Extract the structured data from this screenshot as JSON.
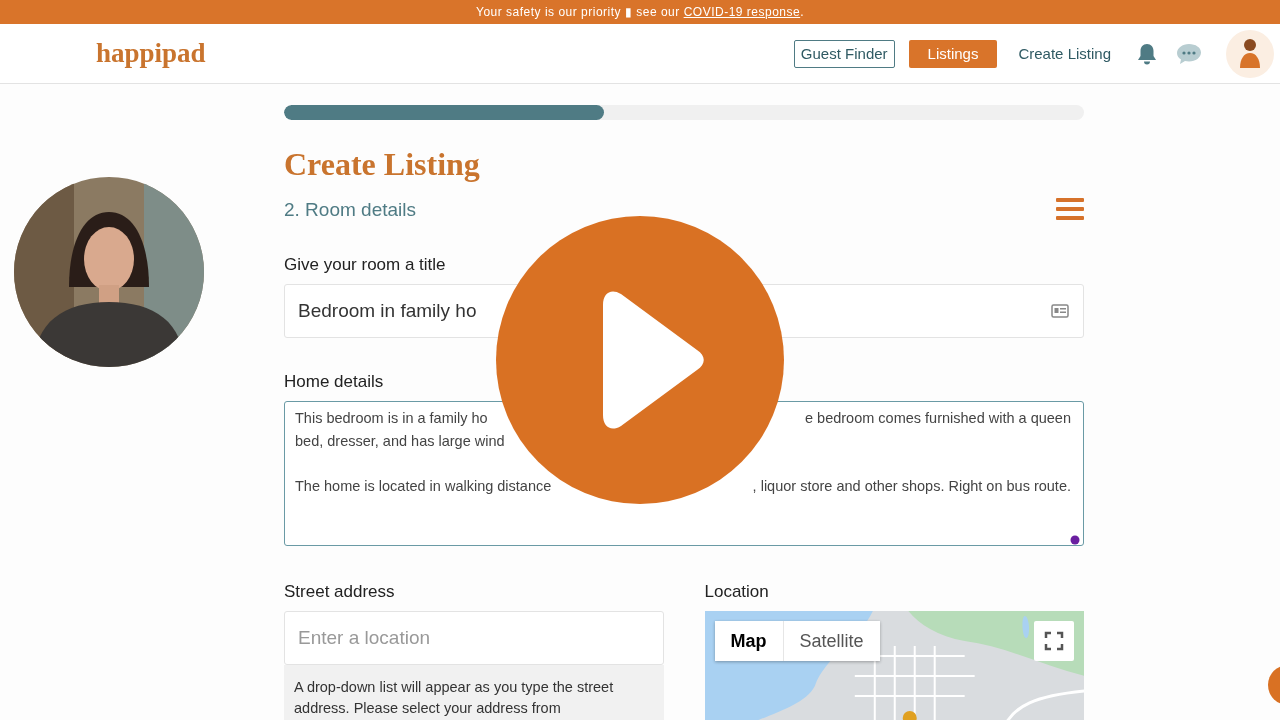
{
  "banner": {
    "text": "Your safety is our priority ▮ see our",
    "link": "COVID-19 response",
    "after": "."
  },
  "header": {
    "logo": "happipad",
    "nav": [
      {
        "label": "Guest Finder",
        "kind": "outline"
      },
      {
        "label": "Listings",
        "kind": "filled"
      },
      {
        "label": "Create Listing",
        "kind": "plain"
      }
    ]
  },
  "progress": {
    "level": 0.4
  },
  "title": "Create Listing",
  "step": "2. Room details",
  "room_title": {
    "label": "Give your room a title",
    "value": "Bedroom in family ho"
  },
  "home_details": {
    "label": "Home details",
    "paragraphs": [
      {
        "lines": [
          {
            "left": "This bedroom is in a family ho",
            "right": "e bedroom comes furnished with a queen"
          },
          {
            "left": "bed, dresser, and has large wind"
          }
        ]
      },
      {
        "lines": [
          {
            "left": "The home is located in walking distance",
            "right": ", liquor store and other shops. Right on bus route."
          }
        ]
      }
    ]
  },
  "street": {
    "label": "Street address",
    "placeholder": "Enter a location",
    "hint": "A drop-down list will appear as you type the street address. Please select your address from"
  },
  "location": {
    "label": "Location",
    "map_types": [
      {
        "label": "Map",
        "selected": true
      },
      {
        "label": "Satellite",
        "selected": false
      }
    ]
  }
}
